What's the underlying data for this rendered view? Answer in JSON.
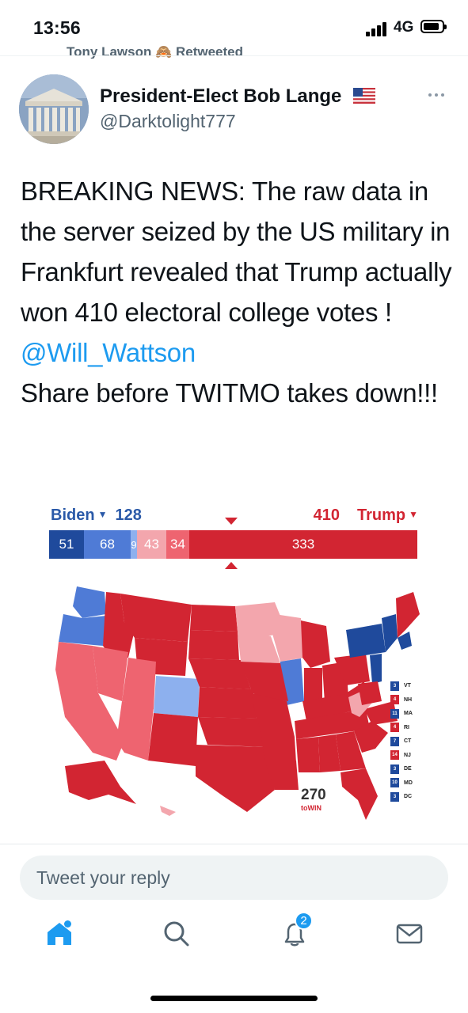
{
  "status_bar": {
    "time": "13:56",
    "network": "4G"
  },
  "retweet_context": {
    "text": "Tony Lawson 🙈 Retweeted"
  },
  "tweet": {
    "author_name": "President-Elect Bob Lange",
    "author_handle": "@Darktolight777",
    "text_before_mention": "BREAKING NEWS: The raw data in the server seized by the US military in Frankfurt revealed that Trump actually won 410 electoral college votes ! ",
    "mention": "@Will_Wattson",
    "text_after_mention": "Share before TWITMO takes down!!!",
    "avatar_icon": "building-icon",
    "flag_icon": "us-flag-icon"
  },
  "electoral_map": {
    "biden_label": "Biden",
    "biden_total": "128",
    "trump_label": "Trump",
    "trump_total": "410",
    "segments": [
      {
        "value": "51",
        "color": "#1f4a9c",
        "share": 0.095
      },
      {
        "value": "68",
        "color": "#4f7bd6",
        "share": 0.126
      },
      {
        "value": "9",
        "color": "#8db0ee",
        "share": 0.017
      },
      {
        "value": "43",
        "color": "#f3a6ad",
        "share": 0.08
      },
      {
        "value": "34",
        "color": "#ee6470",
        "share": 0.063
      },
      {
        "value": "333",
        "color": "#d22532",
        "share": 0.619
      }
    ],
    "small_states": [
      {
        "ev": "3",
        "state": "VT",
        "color": "#1f4a9c"
      },
      {
        "ev": "4",
        "state": "NH",
        "color": "#d22532"
      },
      {
        "ev": "11",
        "state": "MA",
        "color": "#1f4a9c"
      },
      {
        "ev": "4",
        "state": "RI",
        "color": "#d22532"
      },
      {
        "ev": "7",
        "state": "CT",
        "color": "#1f4a9c"
      },
      {
        "ev": "14",
        "state": "NJ",
        "color": "#d22532"
      },
      {
        "ev": "3",
        "state": "DE",
        "color": "#1f4a9c"
      },
      {
        "ev": "10",
        "state": "MD",
        "color": "#1f4a9c"
      },
      {
        "ev": "3",
        "state": "DC",
        "color": "#1f4a9c"
      }
    ],
    "logo_number": "270",
    "logo_text": "toWIN"
  },
  "reply": {
    "placeholder": "Tweet your reply"
  },
  "tab_bar": {
    "notifications_badge": "2",
    "icons": [
      "home-icon",
      "search-icon",
      "notifications-icon",
      "messages-icon"
    ]
  },
  "colors": {
    "accent": "#1d9bf0",
    "dem_dark": "#1f4a9c",
    "rep_solid": "#d22532"
  }
}
